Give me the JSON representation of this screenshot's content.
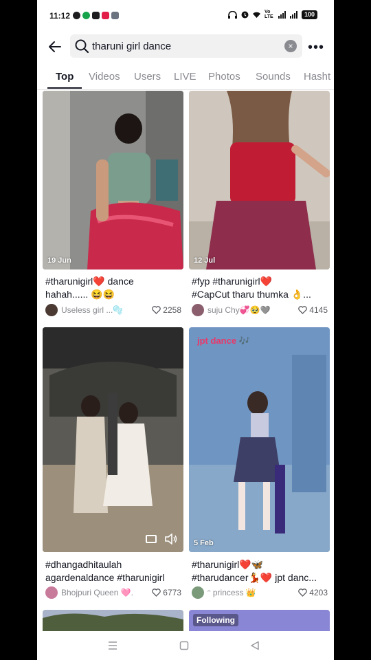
{
  "status": {
    "time": "11:12",
    "net_label": "Vo LTE",
    "battery": "100",
    "app_colors": [
      "#1d1d1f",
      "#16a34a",
      "#1d1d1f",
      "#e11d48",
      "#6b7280"
    ]
  },
  "search": {
    "query": "tharuni girl dance",
    "back_icon": "arrow-left-icon",
    "search_icon": "search-icon",
    "clear_icon": "clear-icon",
    "more_icon": "more-horizontal-icon"
  },
  "tabs": [
    "Top",
    "Videos",
    "Users",
    "LIVE",
    "Photos",
    "Sounds",
    "Hasht"
  ],
  "active_tab": "Top",
  "results": [
    {
      "date": "19 Jun",
      "caption_line1": "#tharunigirl❤️ dance",
      "caption_line2": "hahah...... 😆😆",
      "user": "Useless girl ...🫧",
      "likes": "2258",
      "avatar_color": "#4a3a33"
    },
    {
      "date": "12 Jul",
      "caption_line1": "#fyp #tharunigirl❤️",
      "caption_line2": "#CapCut tharu thumka 👌...",
      "user": "suju Chy💞🥹🩶",
      "likes": "4145",
      "avatar_color": "#8b5e6e"
    },
    {
      "date": "",
      "overlay_icons": [
        "captions-icon",
        "volume-icon"
      ],
      "caption_line1": "#dhangadhitaulah",
      "caption_line2": "agardenaldance #tharunigirl",
      "user": "Bhojpuri Queen 🩷...",
      "likes": "6773",
      "avatar_color": "#c77a9a"
    },
    {
      "date": "5 Feb",
      "overlay_text": "jpt dance 🎶",
      "caption_line1": "#tharunigirl❤️🦋",
      "caption_line2": "#tharudancer💃❤️ jpt danc...",
      "user": "ᵔ princess 👑",
      "likes": "4203",
      "avatar_color": "#7a9a7a"
    }
  ],
  "bottom_badge": "Following",
  "nav": {
    "recents_icon": "recents-icon",
    "home_icon": "home-icon",
    "back_icon": "back-triangle-icon"
  }
}
